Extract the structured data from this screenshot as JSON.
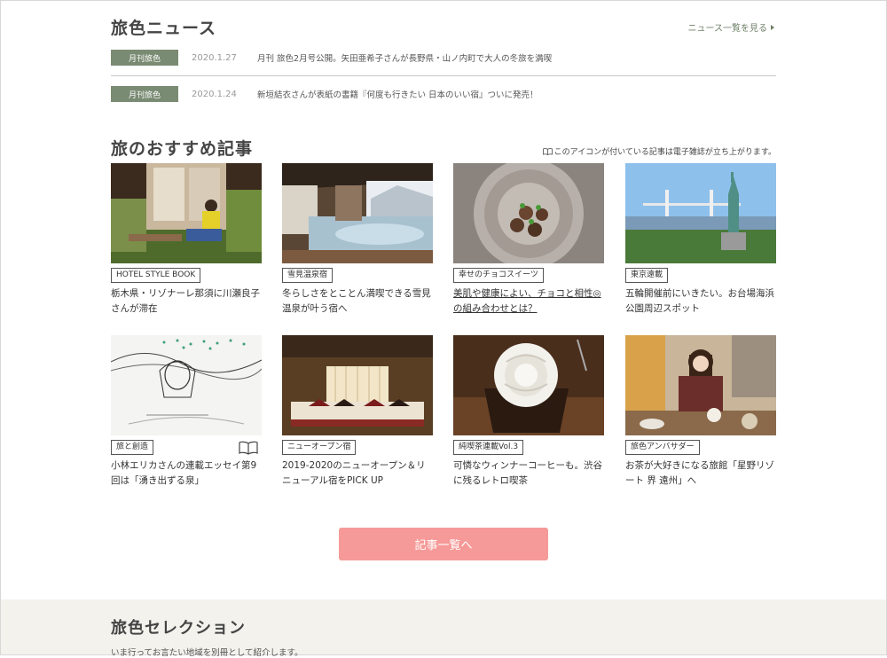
{
  "news": {
    "title": "旅色ニュース",
    "more_label": "ニュース一覧を見る",
    "items": [
      {
        "category": "月刊旅色",
        "date": "2020.1.27",
        "text": "月刊 旅色2月号公開。矢田亜希子さんが長野県・山ノ内町で大人の冬旅を満喫"
      },
      {
        "category": "月刊旅色",
        "date": "2020.1.24",
        "text": "新垣結衣さんが表紙の書籍『何度も行きたい 日本のいい宿』ついに発売！"
      }
    ]
  },
  "recommend": {
    "title": "旅のおすすめ記事",
    "note": "このアイコンが付いている記事は電子雑誌が立ち上がります。",
    "articles": [
      {
        "tag": "HOTEL STYLE BOOK",
        "title": "栃木県・リゾナーレ那須に川瀬良子さんが滞在"
      },
      {
        "tag": "雪見温泉宿",
        "title": "冬らしさをとことん満喫できる雪見温泉が叶う宿へ"
      },
      {
        "tag": "幸せのチョコスイーツ",
        "title": "美肌や健康によい、チョコと相性◎の組み合わせとは？"
      },
      {
        "tag": "東京遠載",
        "title": "五輪開催前にいきたい。お台場海浜公園周辺スポット"
      },
      {
        "tag": "旅と創造",
        "title": "小林エリカさんの連載エッセイ第9回は「湧き出ずる泉」"
      },
      {
        "tag": "ニューオープン宿",
        "title": "2019-2020のニューオープン＆リニューアル宿をPICK UP"
      },
      {
        "tag": "純喫茶連載Vol.3",
        "title": "可憐なウィンナーコーヒーも。渋谷に残るレトロ喫茶"
      },
      {
        "tag": "旅色アンバサダー",
        "title": "お茶が大好きになる旅館「星野リゾート 界 遠州」へ"
      }
    ],
    "button_label": "記事一覧へ"
  },
  "selection": {
    "title": "旅色セレクション",
    "subtitle": "いま行ってお言たい地域を別冊として紹介します。"
  },
  "colors": {
    "accent_green": "#7a8b73",
    "button_pink": "#f59a98",
    "selection_bg": "#f3f2ec"
  }
}
